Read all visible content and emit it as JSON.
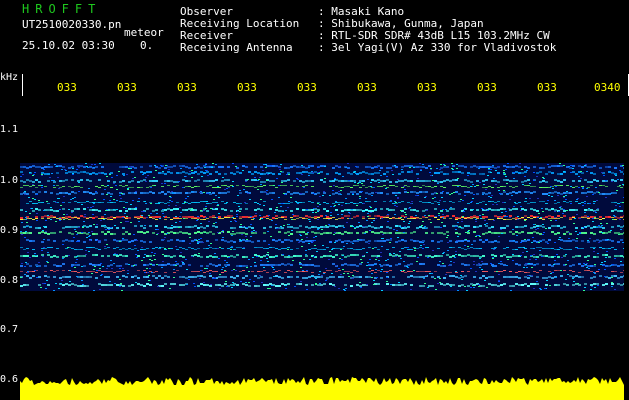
{
  "header": {
    "logo": "HROFFT",
    "filename": "UT2510020330.pn",
    "meteor_label": "meteor",
    "datetime": "25.10.02 03:30",
    "count": "0.",
    "rows": [
      {
        "label": "Observer",
        "value": ": Masaki Kano"
      },
      {
        "label": "Receiving Location",
        "value": ": Shibukawa, Gunma, Japan"
      },
      {
        "label": "Receiver",
        "value": ": RTL-SDR SDR# 43dB L15 103.2MHz CW"
      },
      {
        "label": "Receiving Antenna",
        "value": ": 3el Yagi(V) Az 330 for Vladivostok"
      }
    ]
  },
  "axis": {
    "unit": "kHz",
    "y_ticks": [
      "1.1",
      "1.0",
      "0.9",
      "0.8",
      "0.7",
      "0.6"
    ],
    "time_ticks": [
      "033",
      "033",
      "033",
      "033",
      "033",
      "033",
      "033",
      "033",
      "033",
      "0340"
    ]
  },
  "colors": {
    "logo": "#1ec81e",
    "time_labels": "#ffff00",
    "power_trace": "#ffff00",
    "background": "#000000"
  }
}
